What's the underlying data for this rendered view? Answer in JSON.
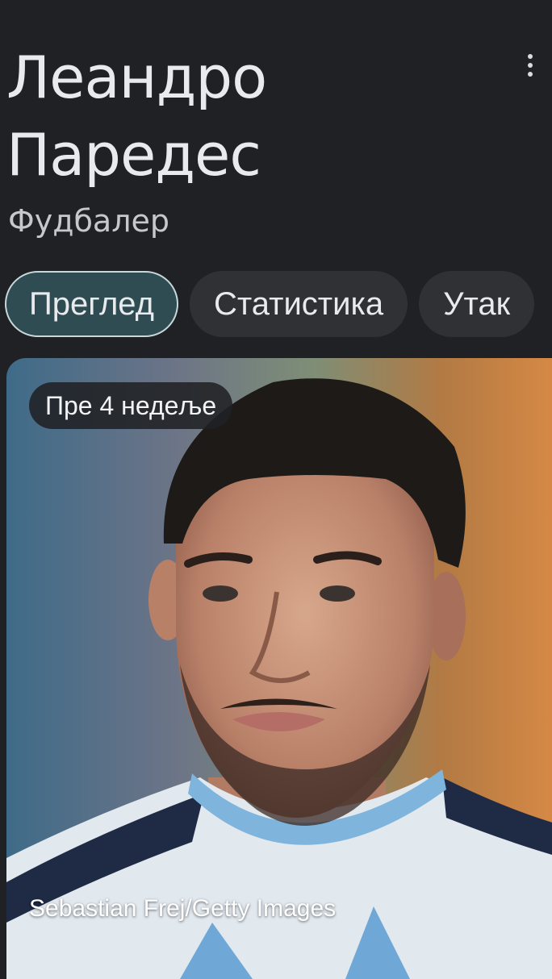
{
  "header": {
    "title_line1": "Леандро",
    "title_line2": "Паредес",
    "subtitle": "Фудбалер",
    "more_icon": "more-vert-icon"
  },
  "tabs": [
    {
      "label": "Преглед",
      "active": true
    },
    {
      "label": "Статистика",
      "active": false
    },
    {
      "label": "Утак",
      "active": false
    }
  ],
  "card": {
    "badge": "Пре 4 недеље",
    "credit": "Sebastian Frej/Getty Images",
    "colors": {
      "jersey_light": "#dfe7ee",
      "jersey_stripe": "#6fa8d6",
      "trim": "#1f2a44"
    }
  }
}
